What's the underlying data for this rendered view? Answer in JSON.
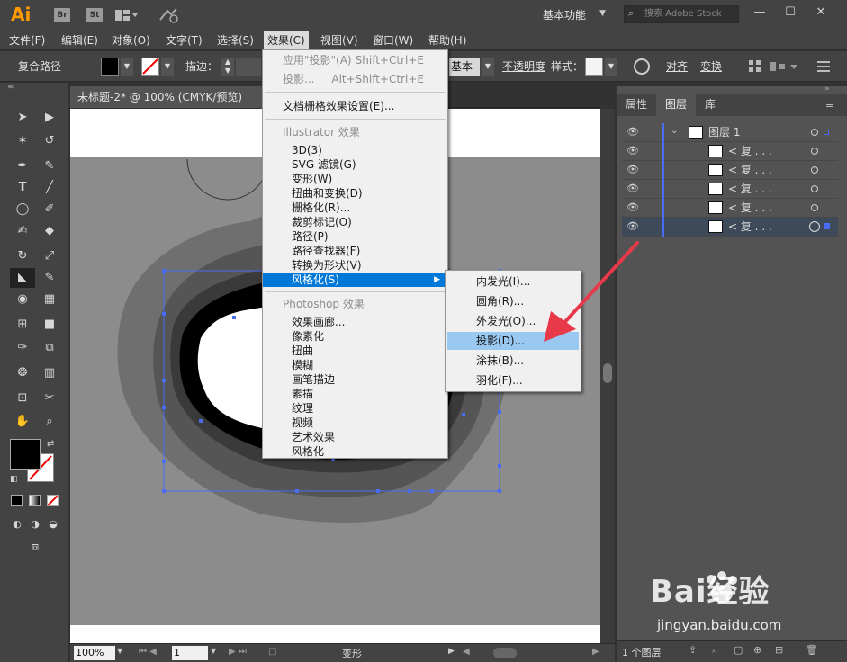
{
  "app": {
    "logo": "Ai",
    "br": "Br",
    "st": "St"
  },
  "titlebar": {
    "workspace": "基本功能",
    "search_placeholder": "搜索 Adobe Stock"
  },
  "menubar": [
    "文件(F)",
    "编辑(E)",
    "对象(O)",
    "文字(T)",
    "选择(S)",
    "效果(C)",
    "视图(V)",
    "窗口(W)",
    "帮助(H)"
  ],
  "controlbar": {
    "object_type": "复合路径",
    "stroke_label": "描边：",
    "basic_label": "基本",
    "opacity_label": "不透明度",
    "style_label": "样式：",
    "align_label": "对齐",
    "transform_label": "变换"
  },
  "document": {
    "tab_title": "未标题-2* @ 100% (CMYK/预览)"
  },
  "effect_menu": {
    "top": [
      {
        "label": "应用\"投影\"(A)",
        "shortcut": "Shift+Ctrl+E",
        "disabled": true
      },
      {
        "label": "投影...",
        "shortcut": "Alt+Shift+Ctrl+E",
        "disabled": true
      }
    ],
    "doc_raster": "文档栅格效果设置(E)...",
    "illustrator_header": "Illustrator 效果",
    "illustrator_items": [
      "3D(3)",
      "SVG 滤镜(G)",
      "变形(W)",
      "扭曲和变换(D)",
      "栅格化(R)...",
      "裁剪标记(O)",
      "路径(P)",
      "路径查找器(F)",
      "转换为形状(V)",
      "风格化(S)"
    ],
    "photoshop_header": "Photoshop 效果",
    "photoshop_items": [
      "效果画廊...",
      "像素化",
      "扭曲",
      "模糊",
      "画笔描边",
      "素描",
      "纹理",
      "视频",
      "艺术效果",
      "风格化"
    ]
  },
  "stylize_submenu": [
    "内发光(I)...",
    "圆角(R)...",
    "外发光(O)...",
    "投影(D)...",
    "涂抹(B)...",
    "羽化(F)..."
  ],
  "panel": {
    "tabs": [
      "属性",
      "图层",
      "库"
    ],
    "layer_name": "图层 1",
    "sublayers": [
      "< 复 . . .",
      "< 复 . . .",
      "< 复 . . .",
      "< 复 . . .",
      "< 复 . . ."
    ],
    "footer_count": "1 个图层"
  },
  "statusbar": {
    "zoom": "100%",
    "page": "1",
    "mode": "变形"
  },
  "watermark": {
    "brand": "Bai经验",
    "url": "jingyan.baidu.com"
  },
  "colors": {
    "accent": "#0078d7",
    "submenu_highlight": "#99c8f0",
    "arrow": "#e8394b",
    "selection": "#4a6cf5"
  }
}
